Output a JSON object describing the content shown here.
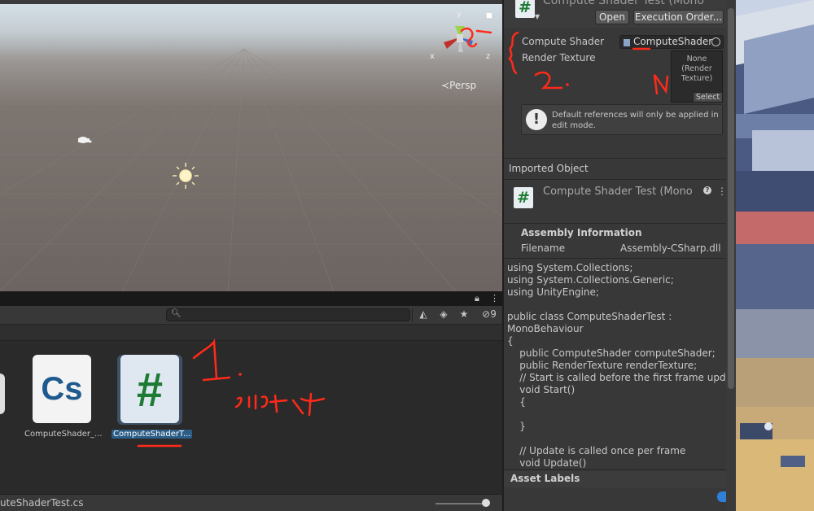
{
  "scene": {
    "view_mode": "Persp",
    "gizmo_axes": {
      "x": "x",
      "y": "y",
      "z": "z"
    }
  },
  "project": {
    "search": {
      "value": "",
      "placeholder": ""
    },
    "hidden_count": "9",
    "assets": [
      {
        "label": "ComputeShader_...",
        "icon_text": "Cs",
        "icon": "csharp-file-icon"
      },
      {
        "label": "ComputeShaderT...",
        "icon_text": "#",
        "icon": "script-file-icon",
        "selected": true
      }
    ],
    "footer_path": "uteShaderTest.cs"
  },
  "inspector": {
    "title": "Compute Shader Test (Mono",
    "buttons": {
      "open": "Open",
      "execution_order": "Execution Order..."
    },
    "properties": [
      {
        "label": "Compute Shader",
        "value": "ComputeShader"
      },
      {
        "label": "Render Texture",
        "value": "None\n(Render\nTexture)"
      }
    ],
    "texture_select": "Select",
    "help_message": "Default references will only be applied in edit mode.",
    "imported_object": {
      "header": "Imported Object",
      "title": "Compute Shader Test (Mono"
    },
    "assembly": {
      "header": "Assembly Information",
      "filename_label": "Filename",
      "filename_value": "Assembly-CSharp.dll"
    },
    "code": "using System.Collections;\nusing System.Collections.Generic;\nusing UnityEngine;\n\npublic class ComputeShaderTest :\nMonoBehaviour\n{\n    public ComputeShader computeShader;\n    public RenderTexture renderTexture;\n    // Start is called before the first frame update\n    void Start()\n    {\n\n    }\n\n    // Update is called once per frame\n    void Update()",
    "asset_labels": "Asset Labels"
  },
  "annotations": {
    "one": "1.",
    "two": "2.",
    "select": "selct"
  },
  "colors": {
    "accent_selection": "#2c5d87",
    "annotation_red": "#ff2a1a",
    "hash_green": "#1e7b34",
    "cs_blue": "#1f5a8f"
  }
}
